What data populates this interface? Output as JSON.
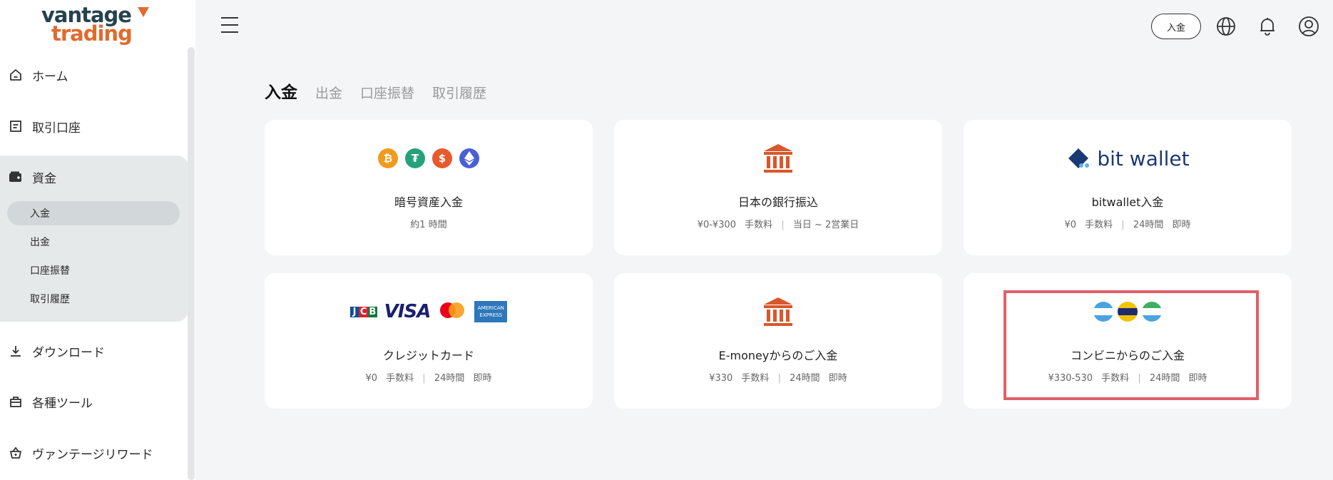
{
  "logo": {
    "line1": "vantage",
    "line2": "trading"
  },
  "sidebar": {
    "items": [
      {
        "label": "ホーム",
        "icon": "home-icon"
      },
      {
        "label": "取引口座",
        "icon": "account-icon"
      },
      {
        "label": "資金",
        "icon": "wallet-icon"
      },
      {
        "label": "ダウンロード",
        "icon": "download-icon"
      },
      {
        "label": "各種ツール",
        "icon": "toolbox-icon"
      },
      {
        "label": "ヴァンテージリワード",
        "icon": "basket-icon"
      }
    ],
    "fund_sub": [
      {
        "label": "入金",
        "active": true
      },
      {
        "label": "出金",
        "active": false
      },
      {
        "label": "口座振替",
        "active": false
      },
      {
        "label": "取引履歴",
        "active": false
      }
    ]
  },
  "header": {
    "deposit_button": "入金",
    "icons": [
      "globe-icon",
      "bell-icon",
      "user-icon"
    ]
  },
  "tabs": [
    {
      "label": "入金",
      "active": true
    },
    {
      "label": "出金",
      "active": false
    },
    {
      "label": "口座振替",
      "active": false
    },
    {
      "label": "取引履歴",
      "active": false
    }
  ],
  "cards": [
    {
      "title": "暗号資産入金",
      "sub": [
        "約1 時間"
      ],
      "icon": "crypto-icons"
    },
    {
      "title": "日本の銀行振込",
      "sub": [
        "¥0-¥300",
        "手数料",
        "当日 ~ 2営業日"
      ],
      "icon": "bank-icon"
    },
    {
      "title": "bitwallet入金",
      "sub": [
        "¥0",
        "手数料",
        "24時間",
        "即時"
      ],
      "icon": "bitwallet-logo",
      "brand": "bit wallet"
    },
    {
      "title": "クレジットカード",
      "sub": [
        "¥0",
        "手数料",
        "24時間",
        "即時"
      ],
      "icon": "card-brand-icons"
    },
    {
      "title": "E-moneyからのご入金",
      "sub": [
        "¥330",
        "手数料",
        "24時間",
        "即時"
      ],
      "icon": "bank-icon"
    },
    {
      "title": "コンビニからのご入金",
      "sub": [
        "¥330-530",
        "手数料",
        "24時間",
        "即時"
      ],
      "icon": "konbini-icons"
    }
  ],
  "colors": {
    "brand_dark": "#25434f",
    "brand_orange": "#e06b2e",
    "highlight": "#e06068",
    "bank": "#d9572b"
  }
}
